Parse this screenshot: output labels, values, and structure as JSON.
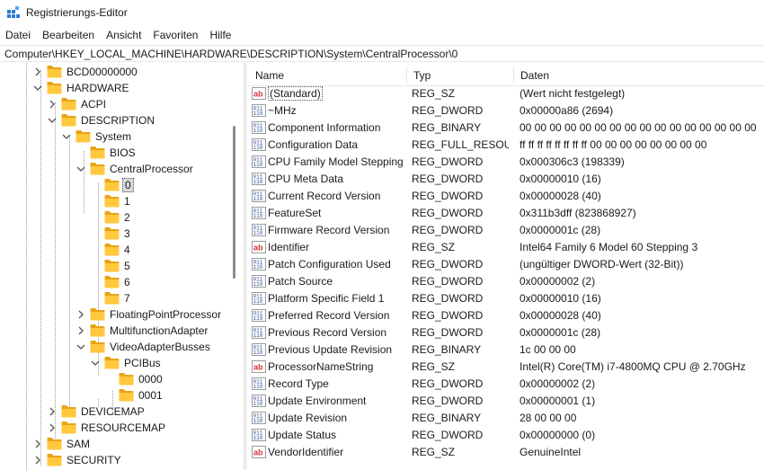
{
  "window": {
    "title": "Registrierungs-Editor"
  },
  "menu": [
    "Datei",
    "Bearbeiten",
    "Ansicht",
    "Favoriten",
    "Hilfe"
  ],
  "address": "Computer\\HKEY_LOCAL_MACHINE\\HARDWARE\\DESCRIPTION\\System\\CentralProcessor\\0",
  "tree": {
    "items": [
      {
        "label": "BCD00000000",
        "state": "collapsed"
      },
      {
        "label": "HARDWARE",
        "state": "expanded"
      },
      {
        "label": "ACPI",
        "state": "collapsed"
      },
      {
        "label": "DESCRIPTION",
        "state": "expanded"
      },
      {
        "label": "System",
        "state": "expanded"
      },
      {
        "label": "BIOS",
        "state": "leaf"
      },
      {
        "label": "CentralProcessor",
        "state": "expanded"
      },
      {
        "label": "0",
        "state": "leaf",
        "selected": true
      },
      {
        "label": "1",
        "state": "leaf"
      },
      {
        "label": "2",
        "state": "leaf"
      },
      {
        "label": "3",
        "state": "leaf"
      },
      {
        "label": "4",
        "state": "leaf"
      },
      {
        "label": "5",
        "state": "leaf"
      },
      {
        "label": "6",
        "state": "leaf"
      },
      {
        "label": "7",
        "state": "leaf"
      },
      {
        "label": "FloatingPointProcessor",
        "state": "collapsed"
      },
      {
        "label": "MultifunctionAdapter",
        "state": "collapsed"
      },
      {
        "label": "VideoAdapterBusses",
        "state": "expanded"
      },
      {
        "label": "PCIBus",
        "state": "expanded"
      },
      {
        "label": "0000",
        "state": "leaf"
      },
      {
        "label": "0001",
        "state": "leaf"
      },
      {
        "label": "DEVICEMAP",
        "state": "collapsed"
      },
      {
        "label": "RESOURCEMAP",
        "state": "collapsed"
      },
      {
        "label": "SAM",
        "state": "collapsed"
      },
      {
        "label": "SECURITY",
        "state": "collapsed"
      }
    ]
  },
  "list": {
    "columns": [
      "Name",
      "Typ",
      "Daten"
    ],
    "rows": [
      {
        "icon": "string-value-icon",
        "name": "(Standard)",
        "type": "REG_SZ",
        "data": "(Wert nicht festgelegt)",
        "focused": true
      },
      {
        "icon": "binary-value-icon",
        "name": "~MHz",
        "type": "REG_DWORD",
        "data": "0x00000a86 (2694)"
      },
      {
        "icon": "binary-value-icon",
        "name": "Component Information",
        "type": "REG_BINARY",
        "data": "00 00 00 00 00 00 00 00 00 00 00 00 00 00 00 00"
      },
      {
        "icon": "binary-value-icon",
        "name": "Configuration Data",
        "type": "REG_FULL_RESOU...",
        "data": "ff ff ff ff ff ff ff ff 00 00 00 00 00 00 00 00"
      },
      {
        "icon": "binary-value-icon",
        "name": "CPU Family Model Stepping",
        "type": "REG_DWORD",
        "data": "0x000306c3 (198339)"
      },
      {
        "icon": "binary-value-icon",
        "name": "CPU Meta Data",
        "type": "REG_DWORD",
        "data": "0x00000010 (16)"
      },
      {
        "icon": "binary-value-icon",
        "name": "Current Record Version",
        "type": "REG_DWORD",
        "data": "0x00000028 (40)"
      },
      {
        "icon": "binary-value-icon",
        "name": "FeatureSet",
        "type": "REG_DWORD",
        "data": "0x311b3dff (823868927)"
      },
      {
        "icon": "binary-value-icon",
        "name": "Firmware Record Version",
        "type": "REG_DWORD",
        "data": "0x0000001c (28)"
      },
      {
        "icon": "string-value-icon",
        "name": "Identifier",
        "type": "REG_SZ",
        "data": "Intel64 Family 6 Model 60 Stepping 3"
      },
      {
        "icon": "binary-value-icon",
        "name": "Patch Configuration Used",
        "type": "REG_DWORD",
        "data": "(ungültiger DWORD-Wert (32-Bit))"
      },
      {
        "icon": "binary-value-icon",
        "name": "Patch Source",
        "type": "REG_DWORD",
        "data": "0x00000002 (2)"
      },
      {
        "icon": "binary-value-icon",
        "name": "Platform Specific Field 1",
        "type": "REG_DWORD",
        "data": "0x00000010 (16)"
      },
      {
        "icon": "binary-value-icon",
        "name": "Preferred Record Version",
        "type": "REG_DWORD",
        "data": "0x00000028 (40)"
      },
      {
        "icon": "binary-value-icon",
        "name": "Previous Record Version",
        "type": "REG_DWORD",
        "data": "0x0000001c (28)"
      },
      {
        "icon": "binary-value-icon",
        "name": "Previous Update Revision",
        "type": "REG_BINARY",
        "data": "1c 00 00 00"
      },
      {
        "icon": "string-value-icon",
        "name": "ProcessorNameString",
        "type": "REG_SZ",
        "data": "Intel(R) Core(TM) i7-4800MQ CPU @ 2.70GHz"
      },
      {
        "icon": "binary-value-icon",
        "name": "Record Type",
        "type": "REG_DWORD",
        "data": "0x00000002 (2)"
      },
      {
        "icon": "binary-value-icon",
        "name": "Update Environment",
        "type": "REG_DWORD",
        "data": "0x00000001 (1)"
      },
      {
        "icon": "binary-value-icon",
        "name": "Update Revision",
        "type": "REG_BINARY",
        "data": "28 00 00 00"
      },
      {
        "icon": "binary-value-icon",
        "name": "Update Status",
        "type": "REG_DWORD",
        "data": "0x00000000 (0)"
      },
      {
        "icon": "string-value-icon",
        "name": "VendorIdentifier",
        "type": "REG_SZ",
        "data": "GenuineIntel"
      }
    ]
  },
  "colors": {
    "folder": "#ffc83d",
    "folder_dark": "#e8a316",
    "string_icon": "#d13438",
    "binary_icon": "#2b579a",
    "selection": "#d9d9d9"
  }
}
